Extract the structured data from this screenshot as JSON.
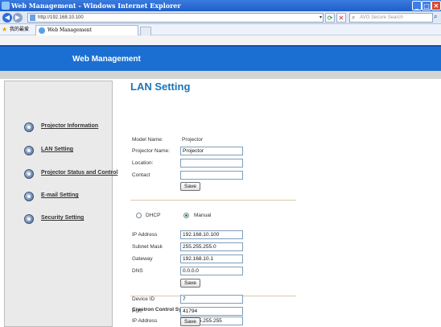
{
  "window": {
    "title": "Web Management - Windows Internet Explorer",
    "address": "http://192.168.10.100",
    "search_placeholder": "AVG Secure Search"
  },
  "favorites": {
    "label": "我的最爱"
  },
  "tab": {
    "label": "Web Management"
  },
  "banner": {
    "title": "Web Management"
  },
  "sidebar": {
    "items": [
      {
        "label": "Projector Information"
      },
      {
        "label": "LAN Setting"
      },
      {
        "label": "Projector Status and Control"
      },
      {
        "label": "E-mail Setting"
      },
      {
        "label": "Security Setting"
      }
    ]
  },
  "main": {
    "heading": "LAN Setting",
    "projector": {
      "model_name_label": "Model Name:",
      "model_name_value": "Projector",
      "projector_name_label": "Projector Name:",
      "projector_name_value": "Projector",
      "location_label": "Location:",
      "location_value": "",
      "contact_label": "Contact",
      "contact_value": "",
      "save_label": "Save"
    },
    "network": {
      "dhcp_label": "DHCP",
      "manual_label": "Manual",
      "mode_selected": "Manual",
      "ip_label": "IP Address",
      "ip_value": "192.168.10.100",
      "subnet_label": "Subnet Mask",
      "subnet_value": "255.255.255.0",
      "gateway_label": "Gateway",
      "gateway_value": "192.168.10.1",
      "dns_label": "DNS",
      "dns_value": "0.0.0.0",
      "save_label": "Save"
    },
    "crestron": {
      "title": "Crestron Control System Device",
      "ip_label": "IP Address",
      "ip_value": "255.255.255.255",
      "device_id_label": "Device ID",
      "device_id_value": "7",
      "port_label": "Port",
      "port_value": "41794",
      "save_label": "Save"
    }
  }
}
